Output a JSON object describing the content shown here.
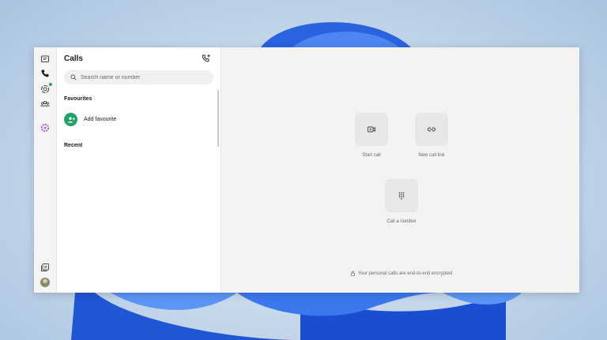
{
  "app": {
    "nav": [
      {
        "id": "chats",
        "icon": "chat-icon"
      },
      {
        "id": "calls",
        "icon": "phone-icon",
        "active": true
      },
      {
        "id": "status",
        "icon": "status-icon",
        "has_badge": true
      },
      {
        "id": "communities",
        "icon": "communities-icon"
      },
      {
        "id": "meta-ai",
        "icon": "meta-ai-icon"
      },
      {
        "id": "archived",
        "icon": "archive-icon"
      },
      {
        "id": "profile",
        "icon": "avatar"
      }
    ],
    "accent_color": "#21a366"
  },
  "calls_panel": {
    "title": "Calls",
    "search_placeholder": "Search name or number",
    "favourites_heading": "Favourites",
    "add_favourite_label": "Add favourite",
    "recent_heading": "Recent"
  },
  "main": {
    "actions": {
      "start_call": "Start call",
      "new_call_link": "New call link",
      "call_number": "Call a number"
    },
    "encryption_notice": "Your personal calls are end-to-end encrypted"
  }
}
